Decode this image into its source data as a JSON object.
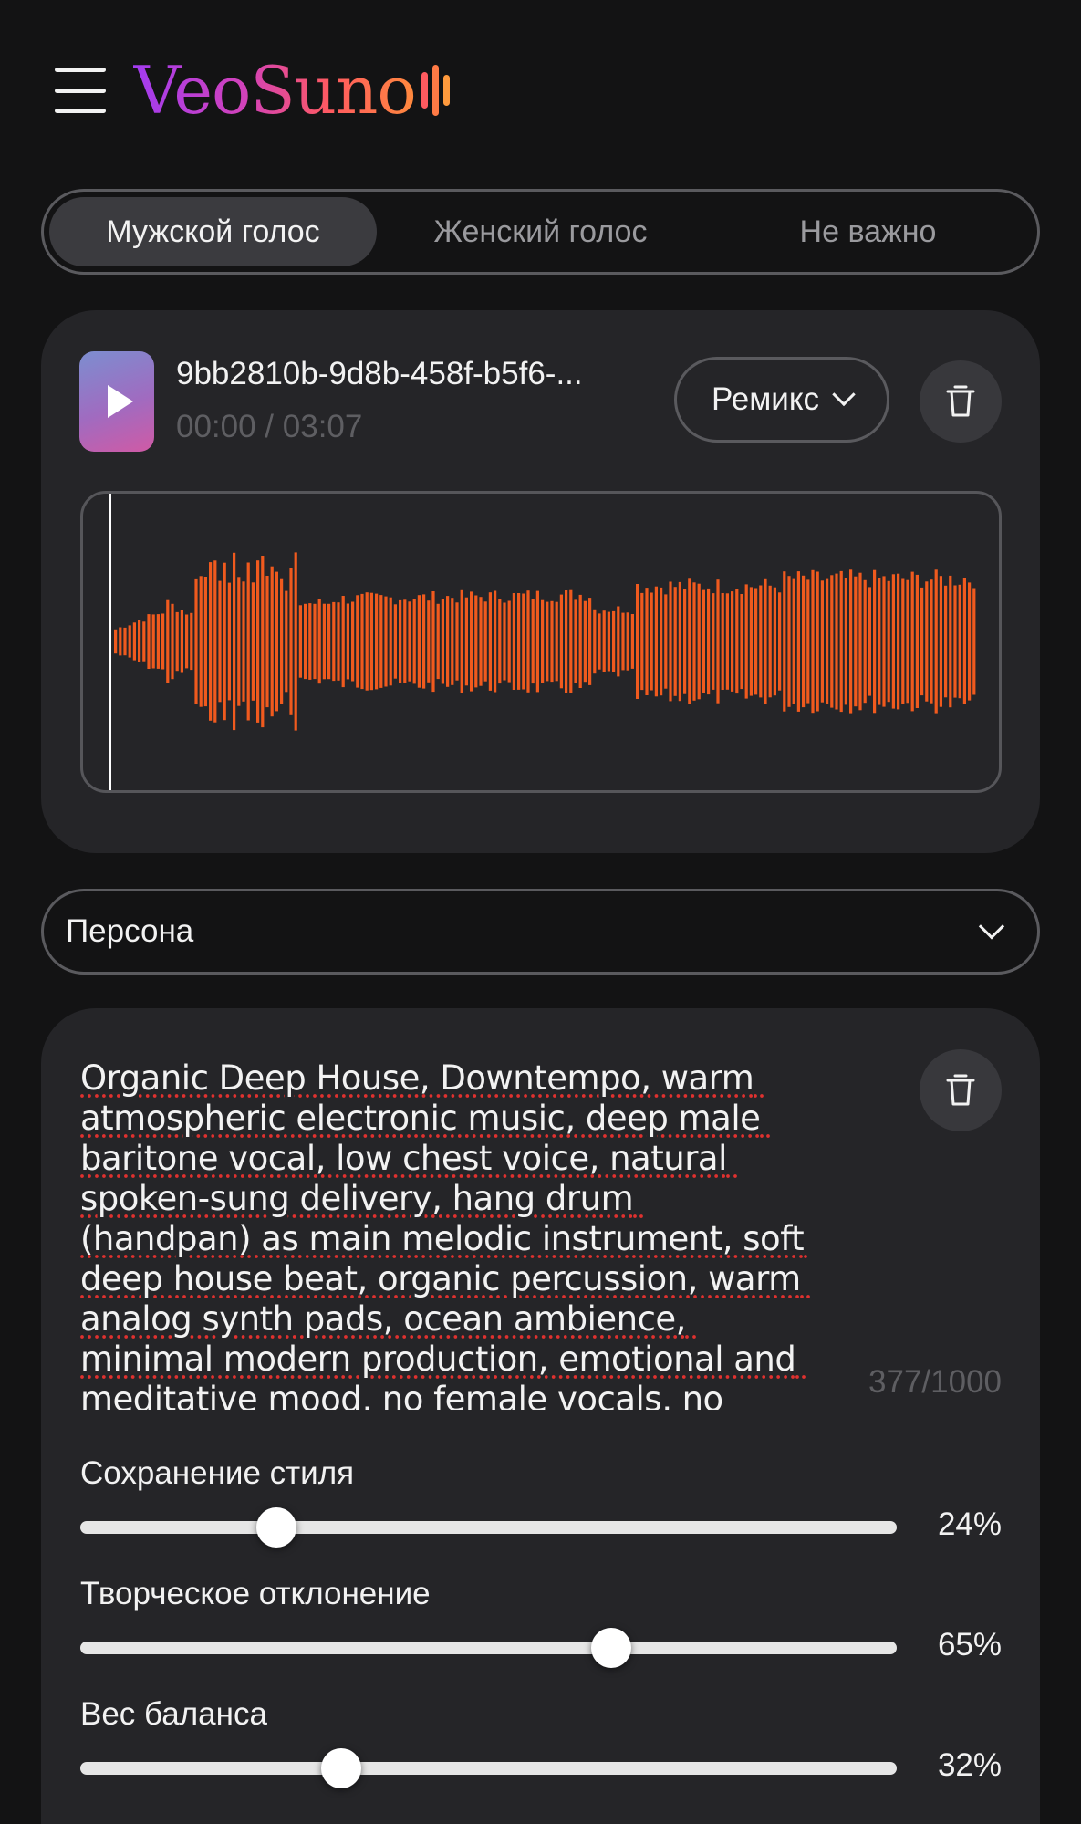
{
  "header": {
    "logo_text": "VeoSuno"
  },
  "voice": {
    "options": [
      "Мужской голос",
      "Женский голос",
      "Не важно"
    ],
    "selected": "Мужской голос"
  },
  "track": {
    "title": "9bb2810b-9d8b-458f-b5f6-...",
    "time": "00:00 / 03:07",
    "remix_label": "Ремикс",
    "progress": 0
  },
  "persona": {
    "label": "Персона"
  },
  "style": {
    "text": "Organic Deep House, Downtempo, warm atmospheric electronic music, deep male baritone vocal, low chest voice, natural spoken-sung delivery, hang drum (handpan) as main melodic instrument, soft deep house beat, organic percussion, warm analog synth pads, ocean ambience, minimal modern production, emotional and meditative mood, no female vocals, no choir, no aggressive elements",
    "char_count": "377/1000"
  },
  "sliders": [
    {
      "label": "Сохранение стиля",
      "value": 24,
      "display": "24%"
    },
    {
      "label": "Творческое отклонение",
      "value": 65,
      "display": "65%"
    },
    {
      "label": "Вес баланса",
      "value": 32,
      "display": "32%"
    }
  ],
  "colors": {
    "accent": "#f05a1e",
    "background": "#131314",
    "card": "#252528"
  }
}
